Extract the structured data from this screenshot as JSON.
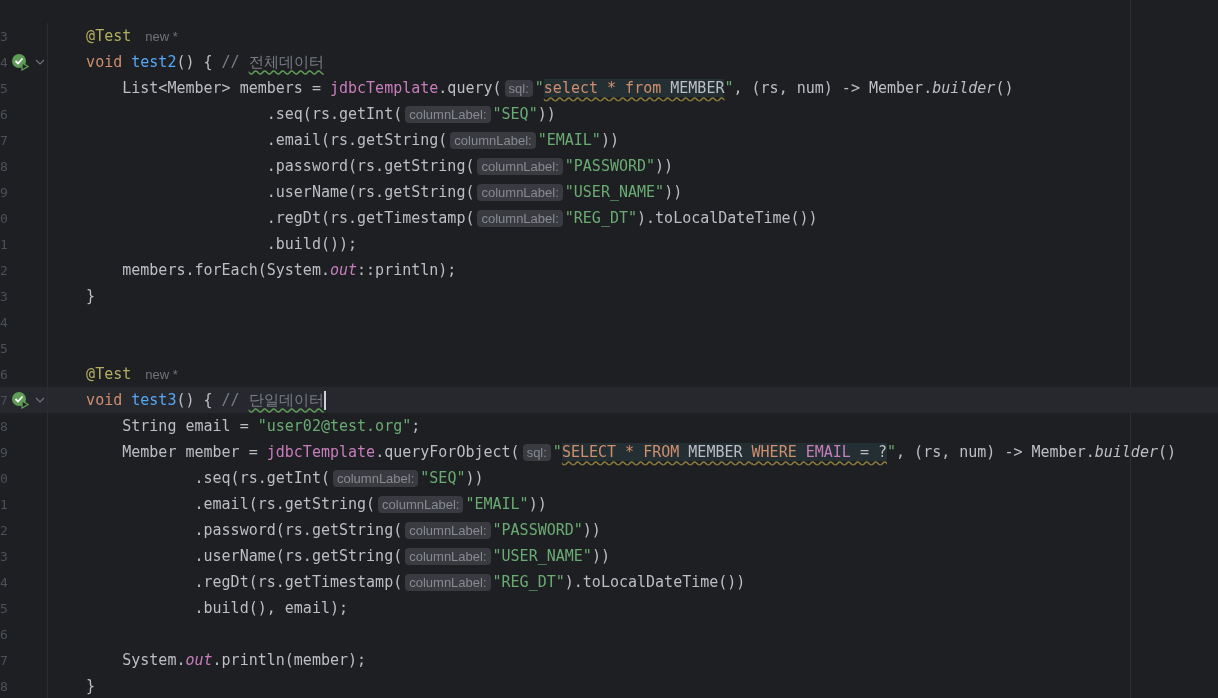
{
  "lines": [
    {
      "n": "3",
      "tokens": [
        {
          "t": "    @Test",
          "kind": "ann"
        },
        {
          "t": "new *",
          "kind": "author"
        }
      ]
    },
    {
      "n": "4",
      "run": true,
      "fold": true,
      "tokens": [
        {
          "t": "    void ",
          "kind": "kw"
        },
        {
          "t": "test2",
          "kind": "fn"
        },
        {
          "t": "() { ",
          "kind": "p"
        },
        {
          "t": "// ",
          "kind": "cmt"
        },
        {
          "t": "전체데이터",
          "kind": "cmt",
          "typo": true
        }
      ]
    },
    {
      "n": "5",
      "tokens": [
        {
          "t": "        List<Member> members = ",
          "kind": "p"
        },
        {
          "t": "jdbcTemplate",
          "kind": "fld"
        },
        {
          "t": ".query(",
          "kind": "p"
        },
        {
          "t": "sql:",
          "kind": "inlay"
        },
        {
          "t": "\"",
          "kind": "str"
        },
        {
          "t": "select * from",
          "kind": "sqlkw",
          "inj": true,
          "warning": true
        },
        {
          "t": " MEMBER",
          "kind": "p",
          "inj": true,
          "warning": true
        },
        {
          "t": "\"",
          "kind": "str"
        },
        {
          "t": ", (rs, num) -> Member.",
          "kind": "p"
        },
        {
          "t": "builder",
          "kind": "it"
        },
        {
          "t": "()",
          "kind": "p"
        }
      ]
    },
    {
      "n": "6",
      "tokens": [
        {
          "t": "                        .seq(rs.getInt(",
          "kind": "p"
        },
        {
          "t": "columnLabel:",
          "kind": "inlay"
        },
        {
          "t": "\"SEQ\"",
          "kind": "str"
        },
        {
          "t": "))",
          "kind": "p"
        }
      ]
    },
    {
      "n": "7",
      "tokens": [
        {
          "t": "                        .email(rs.getString(",
          "kind": "p"
        },
        {
          "t": "columnLabel:",
          "kind": "inlay"
        },
        {
          "t": "\"EMAIL\"",
          "kind": "str"
        },
        {
          "t": "))",
          "kind": "p"
        }
      ]
    },
    {
      "n": "8",
      "tokens": [
        {
          "t": "                        .password(rs.getString(",
          "kind": "p"
        },
        {
          "t": "columnLabel:",
          "kind": "inlay"
        },
        {
          "t": "\"PASSWORD\"",
          "kind": "str"
        },
        {
          "t": "))",
          "kind": "p"
        }
      ]
    },
    {
      "n": "9",
      "tokens": [
        {
          "t": "                        .userName(rs.getString(",
          "kind": "p"
        },
        {
          "t": "columnLabel:",
          "kind": "inlay"
        },
        {
          "t": "\"USER_NAME\"",
          "kind": "str"
        },
        {
          "t": "))",
          "kind": "p"
        }
      ]
    },
    {
      "n": "0",
      "tokens": [
        {
          "t": "                        .regDt(rs.getTimestamp(",
          "kind": "p"
        },
        {
          "t": "columnLabel:",
          "kind": "inlay"
        },
        {
          "t": "\"REG_DT\"",
          "kind": "str"
        },
        {
          "t": ").toLocalDateTime())",
          "kind": "p"
        }
      ]
    },
    {
      "n": "1",
      "tokens": [
        {
          "t": "                        .build());",
          "kind": "p"
        }
      ]
    },
    {
      "n": "2",
      "tokens": [
        {
          "t": "        members.forEach(System.",
          "kind": "p"
        },
        {
          "t": "out",
          "kind": "sfld"
        },
        {
          "t": "::println);",
          "kind": "p"
        }
      ]
    },
    {
      "n": "3",
      "tokens": [
        {
          "t": "    }",
          "kind": "p"
        }
      ]
    },
    {
      "n": "4"
    },
    {
      "n": "5"
    },
    {
      "n": "6",
      "tokens": [
        {
          "t": "    @Test",
          "kind": "ann"
        },
        {
          "t": "new *",
          "kind": "author"
        }
      ]
    },
    {
      "n": "7",
      "run": true,
      "fold": true,
      "current": true,
      "caret": true,
      "tokens": [
        {
          "t": "    void ",
          "kind": "kw"
        },
        {
          "t": "test3",
          "kind": "fn"
        },
        {
          "t": "() { ",
          "kind": "p"
        },
        {
          "t": "// ",
          "kind": "cmt"
        },
        {
          "t": "단일데이터",
          "kind": "cmt",
          "typo": true
        }
      ]
    },
    {
      "n": "8",
      "tokens": [
        {
          "t": "        String email = ",
          "kind": "p"
        },
        {
          "t": "\"user02@test.org\"",
          "kind": "str"
        },
        {
          "t": ";",
          "kind": "p"
        }
      ]
    },
    {
      "n": "9",
      "tokens": [
        {
          "t": "        Member member = ",
          "kind": "p"
        },
        {
          "t": "jdbcTemplate",
          "kind": "fld"
        },
        {
          "t": ".queryForObject(",
          "kind": "p"
        },
        {
          "t": "sql:",
          "kind": "inlay"
        },
        {
          "t": "\"",
          "kind": "str"
        },
        {
          "t": "SELECT * FROM",
          "kind": "sqlkw",
          "inj": true,
          "warning": true
        },
        {
          "t": " MEMBER ",
          "kind": "p",
          "inj": true,
          "warning": true
        },
        {
          "t": "WHERE ",
          "kind": "sqlkw",
          "inj": true,
          "warning": true
        },
        {
          "t": "EMAIL",
          "kind": "fld",
          "inj": true,
          "warning": true
        },
        {
          "t": " = ?",
          "kind": "p",
          "inj": true,
          "warning": true
        },
        {
          "t": "\"",
          "kind": "str"
        },
        {
          "t": ", (rs, num) -> Member.",
          "kind": "p"
        },
        {
          "t": "builder",
          "kind": "it"
        },
        {
          "t": "()",
          "kind": "p"
        }
      ]
    },
    {
      "n": "0",
      "tokens": [
        {
          "t": "                .seq(rs.getInt(",
          "kind": "p"
        },
        {
          "t": "columnLabel:",
          "kind": "inlay"
        },
        {
          "t": "\"SEQ\"",
          "kind": "str"
        },
        {
          "t": "))",
          "kind": "p"
        }
      ]
    },
    {
      "n": "1",
      "tokens": [
        {
          "t": "                .email(rs.getString(",
          "kind": "p"
        },
        {
          "t": "columnLabel:",
          "kind": "inlay"
        },
        {
          "t": "\"EMAIL\"",
          "kind": "str"
        },
        {
          "t": "))",
          "kind": "p"
        }
      ]
    },
    {
      "n": "2",
      "tokens": [
        {
          "t": "                .password(rs.getString(",
          "kind": "p"
        },
        {
          "t": "columnLabel:",
          "kind": "inlay"
        },
        {
          "t": "\"PASSWORD\"",
          "kind": "str"
        },
        {
          "t": "))",
          "kind": "p"
        }
      ]
    },
    {
      "n": "3",
      "tokens": [
        {
          "t": "                .userName(rs.getString(",
          "kind": "p"
        },
        {
          "t": "columnLabel:",
          "kind": "inlay"
        },
        {
          "t": "\"USER_NAME\"",
          "kind": "str"
        },
        {
          "t": "))",
          "kind": "p"
        }
      ]
    },
    {
      "n": "4",
      "tokens": [
        {
          "t": "                .regDt(rs.getTimestamp(",
          "kind": "p"
        },
        {
          "t": "columnLabel:",
          "kind": "inlay"
        },
        {
          "t": "\"REG_DT\"",
          "kind": "str"
        },
        {
          "t": ").toLocalDateTime())",
          "kind": "p"
        }
      ]
    },
    {
      "n": "5",
      "tokens": [
        {
          "t": "                .build(), email);",
          "kind": "p"
        }
      ]
    },
    {
      "n": "6"
    },
    {
      "n": "7",
      "tokens": [
        {
          "t": "        System.",
          "kind": "p"
        },
        {
          "t": "out",
          "kind": "sfld"
        },
        {
          "t": ".println(member);",
          "kind": "p"
        }
      ]
    },
    {
      "n": "8",
      "tokens": [
        {
          "t": "    }",
          "kind": "p"
        }
      ]
    }
  ]
}
